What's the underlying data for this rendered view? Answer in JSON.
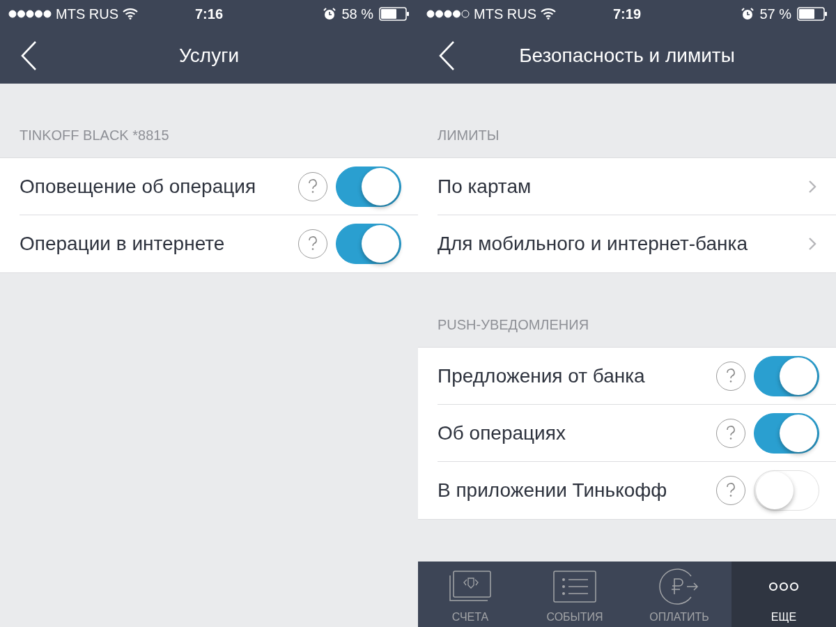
{
  "screens": [
    {
      "status_bar": {
        "carrier": "MTS RUS",
        "time": "7:16",
        "battery": "58 %"
      },
      "nav": {
        "title": "Услуги"
      },
      "sections": [
        {
          "header": "TINKOFF BLACK *8815",
          "rows": [
            {
              "kind": "toggle",
              "label": "Оповещение об операция",
              "on": true
            },
            {
              "kind": "toggle",
              "label": "Операции в интернете",
              "on": true
            }
          ]
        }
      ]
    },
    {
      "status_bar": {
        "carrier": "MTS RUS",
        "time": "7:19",
        "battery": "57 %"
      },
      "nav": {
        "title": "Безопасность и лимиты"
      },
      "sections": [
        {
          "header": "ЛИМИТЫ",
          "rows": [
            {
              "kind": "link",
              "label": "По картам"
            },
            {
              "kind": "link",
              "label": "Для мобильного и интернет-банка"
            }
          ]
        },
        {
          "header": "PUSH-УВЕДОМЛЕНИЯ",
          "rows": [
            {
              "kind": "toggle",
              "label": "Предложения от банка",
              "on": true
            },
            {
              "kind": "toggle",
              "label": "Об операциях",
              "on": true
            },
            {
              "kind": "toggle",
              "label": "В приложении Тинькофф",
              "on": false
            }
          ]
        }
      ],
      "tab_bar": [
        {
          "label": "СЧЕТА",
          "kind": "accounts",
          "selected": false
        },
        {
          "label": "СОБЫТИЯ",
          "kind": "events",
          "selected": false
        },
        {
          "label": "ОПЛАТИТЬ",
          "kind": "pay",
          "selected": false
        },
        {
          "label": "ЕЩЕ",
          "kind": "more",
          "selected": true
        }
      ]
    }
  ]
}
